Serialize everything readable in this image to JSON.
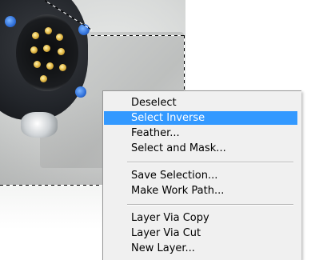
{
  "context_menu": {
    "items": [
      {
        "label": "Deselect"
      },
      {
        "label": "Select Inverse",
        "highlighted": true
      },
      {
        "label": "Feather..."
      },
      {
        "label": "Select and Mask..."
      },
      {
        "label": "Save Selection..."
      },
      {
        "label": "Make Work Path..."
      },
      {
        "label": "Layer Via Copy"
      },
      {
        "label": "Layer Via Cut"
      },
      {
        "label": "New Layer..."
      }
    ],
    "highlight_color": "#3399ff",
    "background_color": "#f0f0f0"
  },
  "canvas": {
    "image_subject": "circular-connector-photo",
    "selection_style": "marching-ants"
  }
}
